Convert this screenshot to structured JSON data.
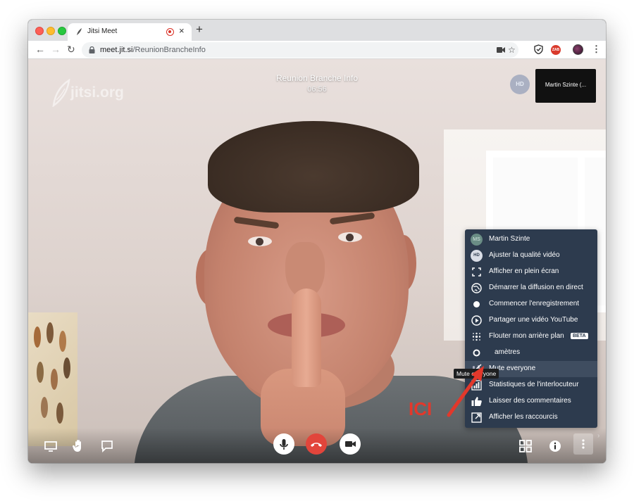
{
  "browser": {
    "tab_title": "Jitsi Meet",
    "url_host": "meet.jit.si",
    "url_path": "/ReunionBrancheInfo",
    "extension_badge": "ZAB"
  },
  "conference": {
    "watermark": "jitsi.org",
    "title": "Reunion Branche Info",
    "timer": "06:56",
    "quality_badge": "HD",
    "thumbnail_name": "Martin Szinte (..."
  },
  "menu": {
    "items": [
      {
        "label": "Martin Szinte",
        "icon": "avatar-ms",
        "avatar_text": "MS"
      },
      {
        "label": "Ajuster la qualité vidéo",
        "icon": "hd-icon",
        "badge": "HD"
      },
      {
        "label": "Afficher en plein écran",
        "icon": "fullscreen-icon"
      },
      {
        "label": "Démarrer la diffusion en direct",
        "icon": "broadcast-icon"
      },
      {
        "label": "Commencer l'enregistrement",
        "icon": "record-icon"
      },
      {
        "label": "Partager une vidéo YouTube",
        "icon": "youtube-icon"
      },
      {
        "label": "Flouter mon arrière plan",
        "icon": "blur-icon",
        "tag": "BETA"
      },
      {
        "label": "Paramètres",
        "visible_label": "amètres",
        "icon": "gear-icon"
      },
      {
        "label": "Mute everyone",
        "icon": "mute-everyone-icon",
        "highlighted": true
      },
      {
        "label": "Statistiques de l'interlocuteur",
        "icon": "stats-icon"
      },
      {
        "label": "Laisser des commentaires",
        "icon": "thumbs-up-icon"
      },
      {
        "label": "Afficher les raccourcis",
        "icon": "shortcuts-icon"
      }
    ],
    "tooltip": "Mute everyone"
  },
  "annotation": {
    "label": "ICI",
    "color": "#e2382b"
  },
  "colors": {
    "menu_bg": "#2d3b4e",
    "hangup": "#e2453b"
  }
}
